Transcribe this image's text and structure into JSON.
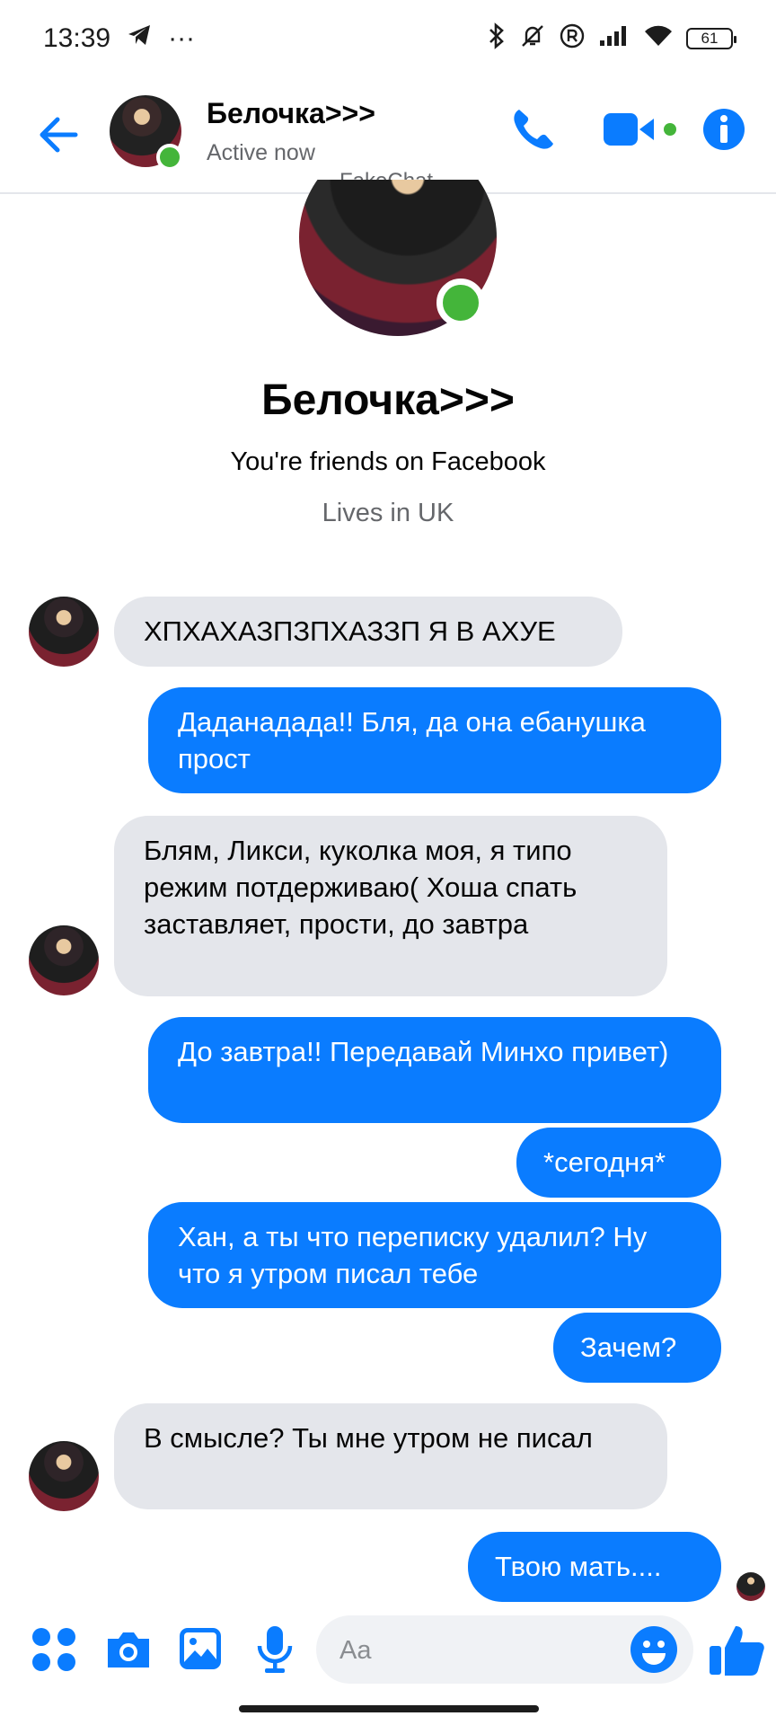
{
  "status_bar": {
    "time": "13:39",
    "more": "···",
    "battery": "61"
  },
  "header": {
    "name": "Белочка>>>",
    "status": "Active now",
    "watermark": "FakeChat"
  },
  "profile": {
    "name": "Белочка>>>",
    "friends_text": "You're friends on Facebook",
    "location": "Lives in UK"
  },
  "messages": [
    {
      "side": "in",
      "text": "ХПХАХАЗПЗПХАЗЗП Я В АХУЕ"
    },
    {
      "side": "out",
      "text": "Даданадада!! Бля, да она ебанушка прост"
    },
    {
      "side": "in",
      "text": "Блям, Ликси, куколка моя, я типо режим потдерживаю( Хоша спать заставляет, прости, до завтра"
    },
    {
      "side": "out",
      "text": "До завтра!! Передавай Минхо привет)"
    },
    {
      "side": "out",
      "text": "*сегодня*"
    },
    {
      "side": "out",
      "text": "Хан, а ты что переписку удалил? Ну что я утром писал тебе"
    },
    {
      "side": "out",
      "text": "Зачем?"
    },
    {
      "side": "in",
      "text": "В смысле? Ты мне утром не писал"
    },
    {
      "side": "out",
      "text": "Твою мать...."
    }
  ],
  "composer": {
    "placeholder": "Aa"
  },
  "colors": {
    "accent": "#0a7cff",
    "online": "#44b53a",
    "incoming_bubble": "#e4e6eb"
  }
}
